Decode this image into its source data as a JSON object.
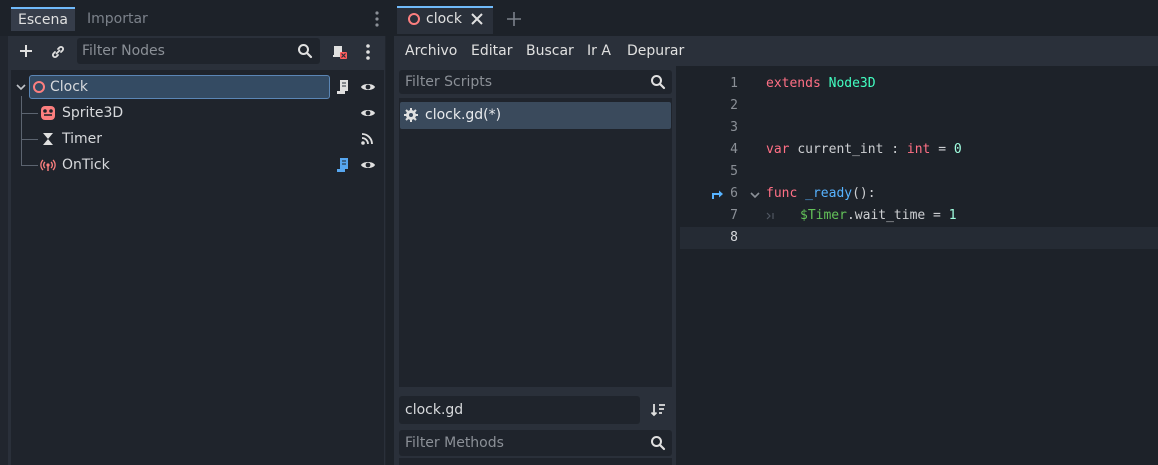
{
  "left_dock": {
    "tabs": [
      {
        "label": "Escena",
        "active": true
      },
      {
        "label": "Importar",
        "active": false
      }
    ],
    "filter_placeholder": "Filter Nodes",
    "nodes": [
      {
        "name": "Clock",
        "icon": "node3d-icon",
        "selected": true,
        "icons": [
          "script-icon",
          "visibility-eye-icon"
        ]
      },
      {
        "name": "Sprite3D",
        "icon": "sprite3d-icon",
        "icons": [
          "visibility-eye-icon"
        ]
      },
      {
        "name": "Timer",
        "icon": "timer-hourglass-icon",
        "icons": [
          "signal-connections-icon"
        ]
      },
      {
        "name": "OnTick",
        "icon": "audio-listener-icon",
        "icons": [
          "script-icon",
          "visibility-eye-icon"
        ]
      }
    ]
  },
  "script_editor": {
    "open_tab": "clock",
    "menu": [
      "Archivo",
      "Editar",
      "Buscar",
      "Ir A",
      "Depurar"
    ],
    "filter_scripts_placeholder": "Filter Scripts",
    "scripts": [
      {
        "name": "clock.gd(*)",
        "selected": true
      }
    ],
    "current_file": "clock.gd",
    "filter_methods_placeholder": "Filter Methods",
    "line_numbers": [
      "1",
      "2",
      "3",
      "4",
      "5",
      "6",
      "7",
      "8"
    ],
    "code": {
      "l1_kw": "extends",
      "l1_type": "Node3D",
      "l4_kw": "var",
      "l4_name": "current_int",
      "l4_colon": ":",
      "l4_type": "int",
      "l4_eq": "=",
      "l4_val": "0",
      "l6_kw": "func",
      "l6_fn": "_ready",
      "l6_rest": "():",
      "l7_node": "$Timer",
      "l7_rest": ".wait_time =",
      "l7_val": "1"
    }
  },
  "colors": {
    "accent": "#70bafa",
    "keyword": "#ff7085",
    "type": "#42ffc2",
    "function": "#57b3ff",
    "number": "#a1ffe0",
    "node_path": "#63c259"
  }
}
